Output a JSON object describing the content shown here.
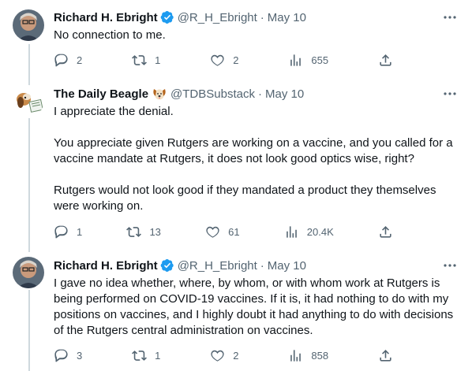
{
  "tweets": [
    {
      "name": "Richard H. Ebright",
      "handle": "@R_H_Ebright",
      "dot": "·",
      "date": "May 10",
      "paragraphs": [
        "No connection to me."
      ],
      "replies": "2",
      "retweets": "1",
      "likes": "2",
      "views": "655",
      "verified": true
    },
    {
      "name": "The Daily Beagle",
      "handle": "@TDBSubstack",
      "dot": "·",
      "date": "May 10",
      "paragraphs": [
        "I appreciate the denial.",
        "You appreciate given Rutgers are working on a vaccine, and you called for a vaccine mandate at Rutgers, it does not look good optics wise, right?",
        "Rutgers would not look good if they mandated a product they themselves were working on."
      ],
      "replies": "1",
      "retweets": "13",
      "likes": "61",
      "views": "20.4K",
      "emoji": "dog-face"
    },
    {
      "name": "Richard H. Ebright",
      "handle": "@R_H_Ebright",
      "dot": "·",
      "date": "May 10",
      "paragraphs": [
        "I gave no idea whether, where, by whom, or with whom work at Rutgers is being performed on COVID-19 vaccines. If it is, it had nothing to do with my positions on vaccines, and I highly doubt it had anything to do with decisions of the Rutgers central administration on vaccines."
      ],
      "replies": "3",
      "retweets": "1",
      "likes": "2",
      "views": "858",
      "verified": true
    }
  ],
  "colors": {
    "verified": "#1d9bf0",
    "secondary_text": "#536471",
    "thread_line": "#cfd9de"
  }
}
